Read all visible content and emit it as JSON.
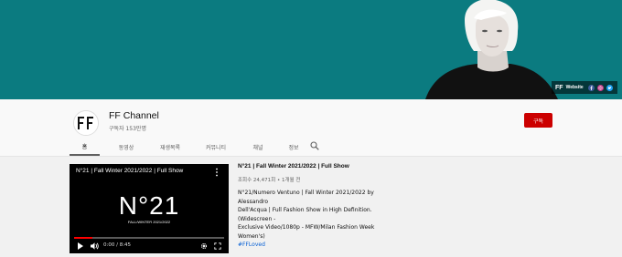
{
  "banner": {
    "brand_mark": "FF",
    "website_label": "Website",
    "social_icons": [
      "facebook-icon",
      "instagram-icon",
      "twitter-icon"
    ],
    "background_color": "#0b7b80"
  },
  "channel": {
    "name": "FF Channel",
    "subscribers": "구독자 153만명",
    "avatar_text": "FF",
    "subscribe_label": "구독",
    "subscribe_color": "#cc0000"
  },
  "tabs": [
    {
      "label": "홈",
      "active": true
    },
    {
      "label": "동영상",
      "active": false
    },
    {
      "label": "재생목록",
      "active": false
    },
    {
      "label": "커뮤니티",
      "active": false
    },
    {
      "label": "채널",
      "active": false
    },
    {
      "label": "정보",
      "active": false
    }
  ],
  "player": {
    "title": "N°21 | Fall Winter 2021/2022 | Full Show",
    "overlay_big": "N°21",
    "overlay_small": "FALL/WINTER 2021/2022",
    "time": "0:00 / 8:45",
    "progress_fraction": 0.12
  },
  "video_info": {
    "title": "N°21 | Fall Winter 2021/2022 | Full Show",
    "meta": "조회수 24,471회 • 1개월 전",
    "description_lines": [
      "N°21/Numero Ventuno | Fall Winter 2021/2022 by Alessandro",
      "Dell'Acqua | Full Fashion Show in High Definition. (Widescreen -",
      "Exclusive Video/1080p - MFW/Milan Fashion Week Women's)"
    ],
    "hashtag": "#FFLoved"
  }
}
